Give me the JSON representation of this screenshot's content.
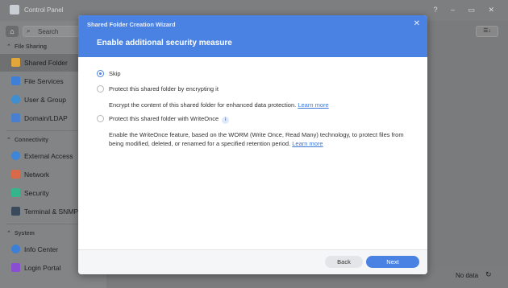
{
  "control_panel": {
    "title": "Control Panel",
    "window_buttons": "? – ▭ ✕",
    "search_placeholder": "Search",
    "sections": {
      "file_sharing": "File Sharing",
      "connectivity": "Connectivity",
      "system": "System"
    },
    "items": {
      "shared_folder": "Shared Folder",
      "file_services": "File Services",
      "user_group": "User & Group",
      "domain_ldap": "Domain/LDAP",
      "external_access": "External Access",
      "network": "Network",
      "security": "Security",
      "terminal_snmp": "Terminal & SNMP",
      "info_center": "Info Center",
      "login_portal": "Login Portal"
    },
    "footer": {
      "no_data": "No data"
    }
  },
  "dialog": {
    "caption": "Shared Folder Creation Wizard",
    "heading": "Enable additional security measure",
    "options": {
      "skip": "Skip",
      "encrypt": "Protect this shared folder by encrypting it",
      "encrypt_desc": "Encrypt the content of this shared folder for enhanced data protection.",
      "writeonce": "Protect this shared folder with WriteOnce",
      "writeonce_desc": "Enable the WriteOnce feature, based on the WORM (Write Once, Read Many) technology, to protect files from being modified, deleted, or renamed for a specified retention period.",
      "learn_more": "Learn more"
    },
    "selected_option": "Skip",
    "buttons": {
      "back": "Back",
      "next": "Next"
    }
  },
  "colors": {
    "accent": "#4a82e3",
    "link": "#3d78d8"
  }
}
